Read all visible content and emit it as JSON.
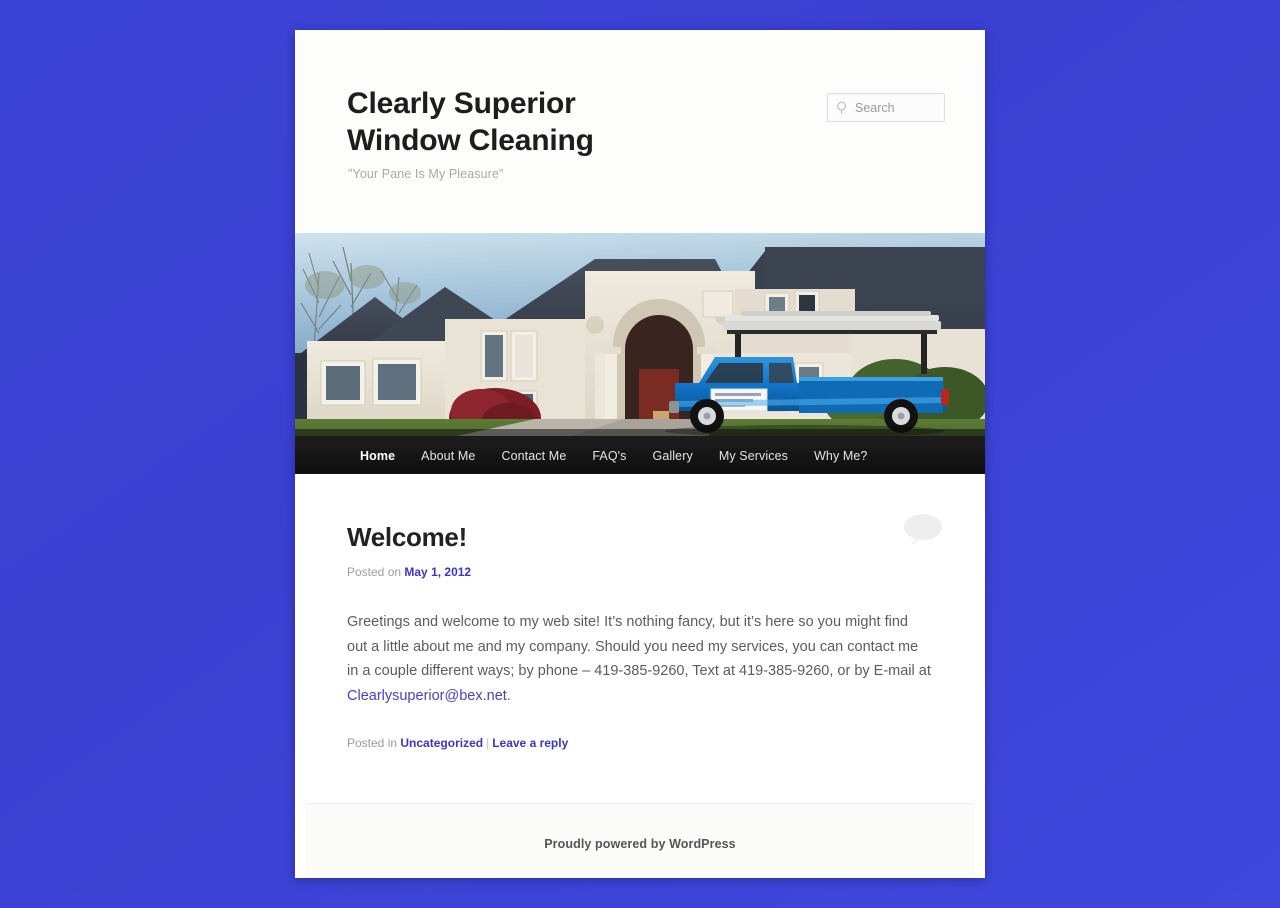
{
  "background_color": "#3a43d4",
  "branding": {
    "site_title": "Clearly Superior Window Cleaning",
    "site_description": "\"Your Pane Is My Pleasure\""
  },
  "search": {
    "placeholder": "Search",
    "value": "",
    "icon": "search-icon"
  },
  "header_image": {
    "alt": "Blue pickup truck with ladder rack parked in front of a large cream stucco house",
    "sky_color": "#b9cede",
    "roof_color": "#3d4452",
    "house_color": "#e6e0d4",
    "truck_color": "#1a7fd4",
    "lawn_color": "#4e6b2e",
    "street_color": "#3a3a3c"
  },
  "nav": {
    "items": [
      {
        "label": "Home",
        "current": true
      },
      {
        "label": "About Me",
        "current": false
      },
      {
        "label": "Contact Me",
        "current": false
      },
      {
        "label": "FAQ's",
        "current": false
      },
      {
        "label": "Gallery",
        "current": false
      },
      {
        "label": "My Services",
        "current": false
      },
      {
        "label": "Why Me?",
        "current": false
      }
    ]
  },
  "post": {
    "title": "Welcome!",
    "posted_label": "Posted on",
    "date": "May 1, 2012",
    "body_part_1": "Greetings and welcome to my web site! It’s nothing fancy, but it’s here so you might find out a little about me and my company. Should you need my services, you can contact me in a couple different ways; by phone – 419-385-9260, Text at 419-385-9260, or by E-mail at ",
    "email_link": "Clearlysuperior@bex.net",
    "body_part_2": ".",
    "phone": "419-385-9260",
    "text_number": "419-385-9260",
    "posted_in_label": "Posted in",
    "category": "Uncategorized",
    "meta_separator": "|",
    "reply_link": "Leave a reply",
    "comment_bubble": "comment-bubble-icon"
  },
  "footer": {
    "credit": "Proudly powered by WordPress"
  }
}
